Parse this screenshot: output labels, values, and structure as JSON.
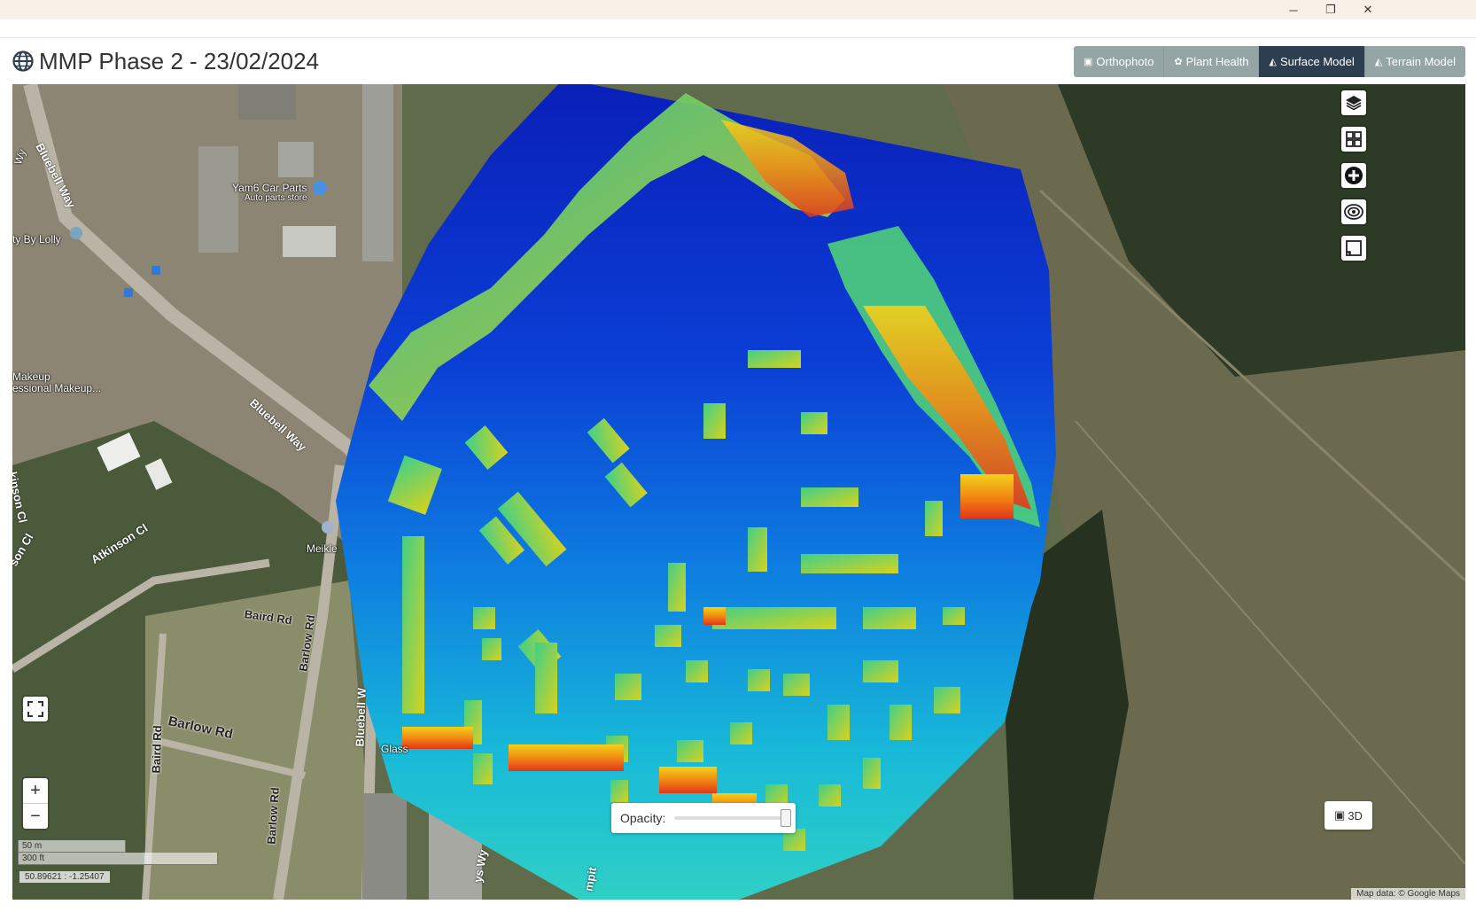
{
  "window": {
    "minimize": "─",
    "restore": "❐",
    "close": "✕"
  },
  "header": {
    "title": "MMP Phase 2 - 23/02/2024",
    "icon": "globe-icon"
  },
  "view_buttons": [
    {
      "label": "Orthophoto",
      "icon": "image-icon",
      "active": false
    },
    {
      "label": "Plant Health",
      "icon": "plant-icon",
      "active": false
    },
    {
      "label": "Surface Model",
      "icon": "area-chart-icon",
      "active": true
    },
    {
      "label": "Terrain Model",
      "icon": "area-chart-icon",
      "active": false
    }
  ],
  "map_controls": [
    "layers-icon",
    "grid-icon",
    "plus-circle-icon",
    "eye-icon",
    "measure-icon"
  ],
  "zoom": {
    "in": "+",
    "out": "−"
  },
  "scale": {
    "metric": "50 m",
    "imperial": "300 ft"
  },
  "coordinates": "50.89621 : -1.25407",
  "opacity": {
    "label": "Opacity:",
    "value": 1.0
  },
  "btn_3d": "3D",
  "attribution": "Map data: © Google Maps",
  "map_labels": {
    "bluebell_way_top": "Bluebell Way",
    "bluebell_way_mid": "Bluebell Way",
    "bluebell_way_bottom": "Bluebell W",
    "yam6": "Yam6 Car Parts",
    "yam6_sub": "Auto parts store",
    "beauty": "ty By Lolly",
    "makeup": "Makeup",
    "makeup_sub": "essional Makeup...",
    "way": "Wy",
    "atkinson_cl": "Atkinson Cl",
    "atkinson_cl_left": "kinson Cl",
    "son_cl": "son Cl",
    "meikle": "Meikle",
    "baird_rd": "Baird Rd",
    "baird_rd_vert": "Baird Rd",
    "barlow_rd": "Barlow Rd",
    "barlow_rd_vert": "Barlow Rd",
    "barlow_rd_vert2": "Barlow Rd",
    "glass": "Glass",
    "ys_wy": "ys Wy",
    "mpit": "mpit"
  }
}
